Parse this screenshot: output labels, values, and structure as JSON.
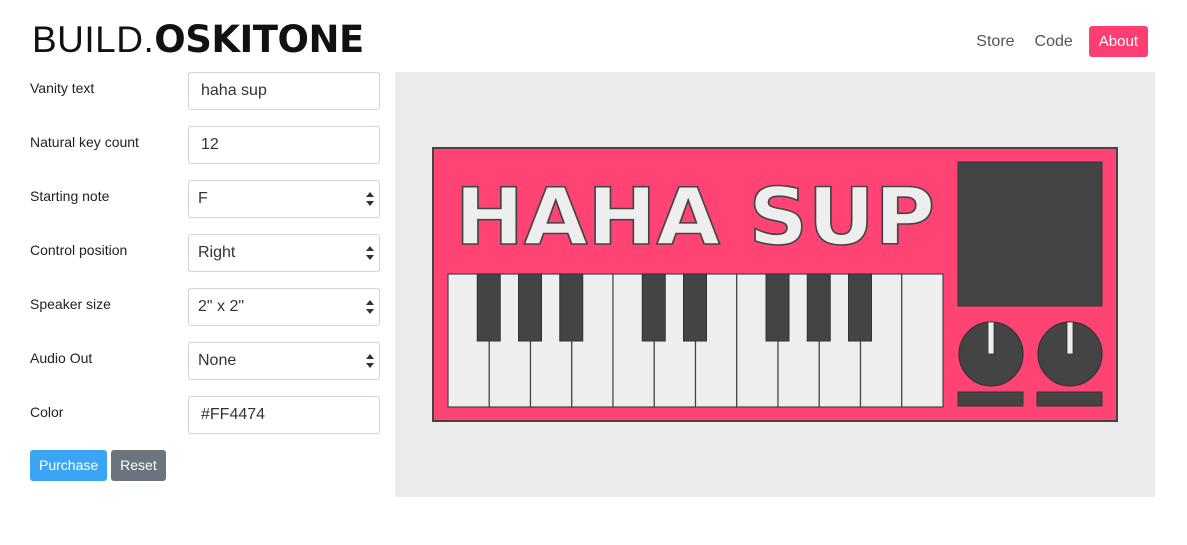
{
  "header": {
    "logo_light": "BUILD.",
    "logo_bold": "OSKITONE",
    "nav": [
      {
        "label": "Store"
      },
      {
        "label": "Code"
      },
      {
        "label": "About",
        "active": true
      }
    ]
  },
  "form": {
    "vanity_text": {
      "label": "Vanity text",
      "value": "haha sup"
    },
    "key_count": {
      "label": "Natural key count",
      "value": "12"
    },
    "starting_note": {
      "label": "Starting note",
      "value": "F"
    },
    "control_position": {
      "label": "Control position",
      "value": "Right"
    },
    "speaker_size": {
      "label": "Speaker size",
      "value": "2\" x 2\""
    },
    "audio_out": {
      "label": "Audio Out",
      "value": "None"
    },
    "color": {
      "label": "Color",
      "value": "#FF4474"
    },
    "purchase_label": "Purchase",
    "reset_label": "Reset"
  },
  "preview": {
    "display_text": "HAHA SUP",
    "body_color": "#FF4474",
    "natural_keys": 12,
    "accidental_pattern": [
      true,
      true,
      true,
      false,
      true,
      true,
      false,
      true,
      true,
      true,
      false,
      false
    ],
    "knobs": 2
  },
  "colors": {
    "accent": "#FF3E74",
    "primary_button": "#3BA5F5",
    "secondary_button": "#6C757D",
    "dark_part": "#444444",
    "key_white": "#EEEEEE"
  }
}
